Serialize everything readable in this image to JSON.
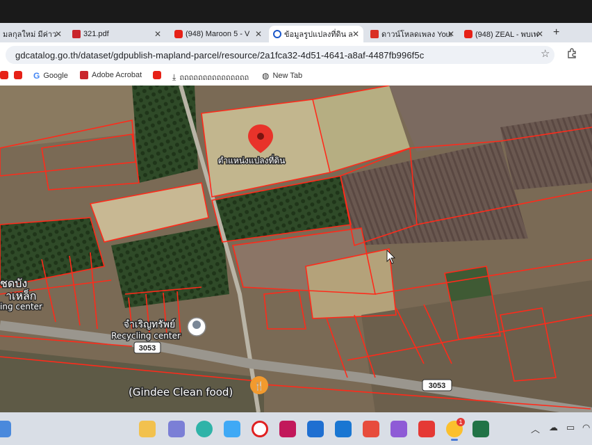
{
  "browser": {
    "tabs": [
      {
        "label": "มลกุลใหม่ มีค่าว",
        "icon": "generic-page-icon"
      },
      {
        "label": "321.pdf",
        "icon": "pdf-icon"
      },
      {
        "label": "(948) Maroon 5 - V",
        "icon": "youtube-icon"
      },
      {
        "label": "ข้อมูลรูปแปลงที่ดิน ล",
        "icon": "gdcatalog-icon",
        "active": true
      },
      {
        "label": "ดาวน์โหลดเพลง Your",
        "icon": "download-icon"
      },
      {
        "label": "(948) ZEAL - พบเพ",
        "icon": "youtube-icon"
      }
    ],
    "new_tab_symbol": "+",
    "close_symbol": "✕",
    "url": "gdcatalog.go.th/dataset/gdpublish-mapland-parcel/resource/2a1fca32-4d51-4641-a8af-4487fb996f5c",
    "bookmarks": [
      {
        "label": "",
        "icon": "youtube-icon"
      },
      {
        "label": "Google",
        "icon": "google-icon"
      },
      {
        "label": "Adobe Acrobat",
        "icon": "acrobat-icon"
      },
      {
        "label": "",
        "icon": "youtube-icon"
      },
      {
        "label": "ถถถถถถถถถถถถถถถ",
        "icon": "download-icon"
      },
      {
        "label": "New Tab",
        "icon": "globe-icon"
      }
    ]
  },
  "map": {
    "parcel_label": "ตำแหน่งแปลงที่ดิน",
    "recycling_thai": "จำเริญทรัพย์",
    "recycling_en": "Recycling center",
    "left_label_1": "ชดบัง",
    "left_label_2": "าเหล็ก",
    "left_label_3": "ing center",
    "restaurant": "(Gindee Clean food)",
    "road_1": "3053",
    "road_2": "3053"
  },
  "taskbar": {
    "notification_badge": "1"
  },
  "colors": {
    "parcel_line": "#ff2a1a",
    "pin": "#e8332a",
    "tab_bar": "#dfe3ea"
  }
}
